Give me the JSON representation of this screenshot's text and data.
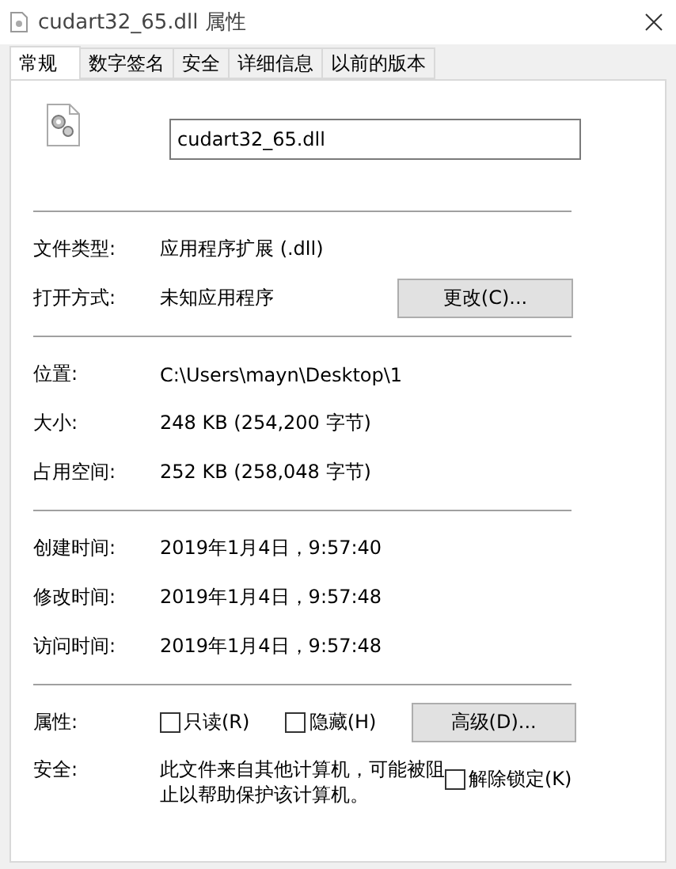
{
  "window": {
    "title": "cudart32_65.dll 属性"
  },
  "tabs": [
    {
      "label": "常规",
      "selected": true
    },
    {
      "label": "数字签名",
      "selected": false
    },
    {
      "label": "安全",
      "selected": false
    },
    {
      "label": "详细信息",
      "selected": false
    },
    {
      "label": "以前的版本",
      "selected": false
    }
  ],
  "file_name": {
    "value": "cudart32_65.dll"
  },
  "sections": [
    {
      "rows": [
        {
          "label": "文件类型:",
          "value": "应用程序扩展 (.dll)"
        },
        {
          "label": "打开方式:",
          "value": "未知应用程序",
          "button": "更改(C)..."
        }
      ]
    },
    {
      "rows": [
        {
          "label": "位置:",
          "value": "C:\\Users\\mayn\\Desktop\\1"
        },
        {
          "label": "大小:",
          "value": "248 KB (254,200 字节)"
        },
        {
          "label": "占用空间:",
          "value": "252 KB (258,048 字节)"
        }
      ]
    },
    {
      "rows": [
        {
          "label": "创建时间:",
          "value": "2019年1月4日，9:57:40"
        },
        {
          "label": "修改时间:",
          "value": "2019年1月4日，9:57:48"
        },
        {
          "label": "访问时间:",
          "value": "2019年1月4日，9:57:48"
        }
      ]
    }
  ],
  "attributes": {
    "label": "属性:",
    "checkboxes": [
      {
        "label": "只读(R)",
        "checked": false
      },
      {
        "label": "隐藏(H)",
        "checked": false
      }
    ],
    "button": "高级(D)..."
  },
  "security": {
    "label": "安全:",
    "text": "此文件来自其他计算机，可能被阻止以帮助保护该计算机。",
    "checkbox": {
      "label": "解除锁定(K)",
      "checked": false
    }
  }
}
